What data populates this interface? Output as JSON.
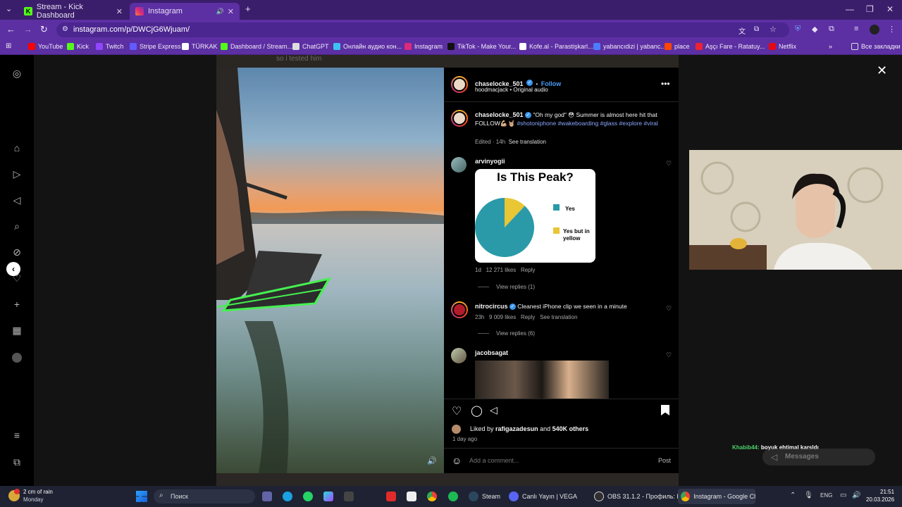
{
  "browser": {
    "tabs": [
      {
        "title": "Stream - Kick Dashboard",
        "favicon": "K",
        "active": false
      },
      {
        "title": "Instagram",
        "favicon": "instagram-icon",
        "active": true
      }
    ],
    "url": "instagram.com/p/DWCjG6Wjuam/",
    "bookmarks": [
      "YouTube",
      "Kick",
      "Twitch",
      "Stripe Express",
      "TÜRKAK",
      "Dashboard / Stream...",
      "ChatGPT",
      "Онлайн аудио кон...",
      "Instagram",
      "TikTok - Make Your...",
      "Kofe.al - Parastişkarl...",
      "yabancıdizi | yabanc...",
      "place",
      "Aşçı Fare - Ratatuy...",
      "Netflix"
    ],
    "bookmarks_folder": "Все закладки",
    "colors": {
      "frame": "#3b1e6b",
      "toolbar": "#5c2fa3"
    }
  },
  "background": {
    "caption": "so i tested him"
  },
  "post": {
    "author": "chaselocke_501",
    "follow_label": "Follow",
    "audio": "hoodmacjack • Original audio",
    "caption_author": "chaselocke_501",
    "caption_text": "\"Oh my god\" 😳 Summer is almost here hit that FOLLOW💪🏼🤘🏼",
    "hashtags": "#shotoniphone #wakeboarding #glass #explore #viral",
    "caption_meta": "Edited · 14h",
    "see_translation": "See translation",
    "comments": [
      {
        "user": "arvinyogii",
        "verified": false,
        "text": "",
        "time": "1d",
        "likes": "12 271 likes",
        "reply": "Reply",
        "view_replies": "View replies (1)",
        "translate": ""
      },
      {
        "user": "nitrocircus",
        "verified": true,
        "text": "Cleanest iPhone clip we seen in a minute",
        "time": "23h",
        "likes": "9 009 likes",
        "reply": "Reply",
        "view_replies": "View replies (6)",
        "translate": "See translation"
      },
      {
        "user": "jacobsagat",
        "verified": false,
        "text": "",
        "time": "",
        "likes": "",
        "reply": "",
        "view_replies": "",
        "translate": ""
      }
    ],
    "liked_by_prefix": "Liked by",
    "liked_by_user": "rafigazadesun",
    "liked_by_and": "and",
    "liked_by_others": "540K others",
    "age": "1 day ago",
    "comment_placeholder": "Add a comment...",
    "post_button": "Post"
  },
  "chart_data": {
    "type": "pie",
    "title": "Is This Peak?",
    "categories": [
      "Yes",
      "Yes but in yellow"
    ],
    "values": [
      88,
      12
    ],
    "colors": [
      "#2a9aa8",
      "#e8c634"
    ],
    "legend": "right"
  },
  "stream_chat": {
    "user": "Khabib44:",
    "text": "boyuk ehtimal karsldı",
    "messages_label": "Messages"
  },
  "taskbar": {
    "weather": "2 cm of rain",
    "day": "Monday",
    "search": "Поиск",
    "apps": [
      "Steam",
      "Canlı Yayın | VEGA",
      "OBS 31.1.2 - Профиль: Б",
      "Instagram - Google Chr"
    ],
    "lang": "ENG",
    "time": "21:51",
    "date": "20.03.2026"
  }
}
